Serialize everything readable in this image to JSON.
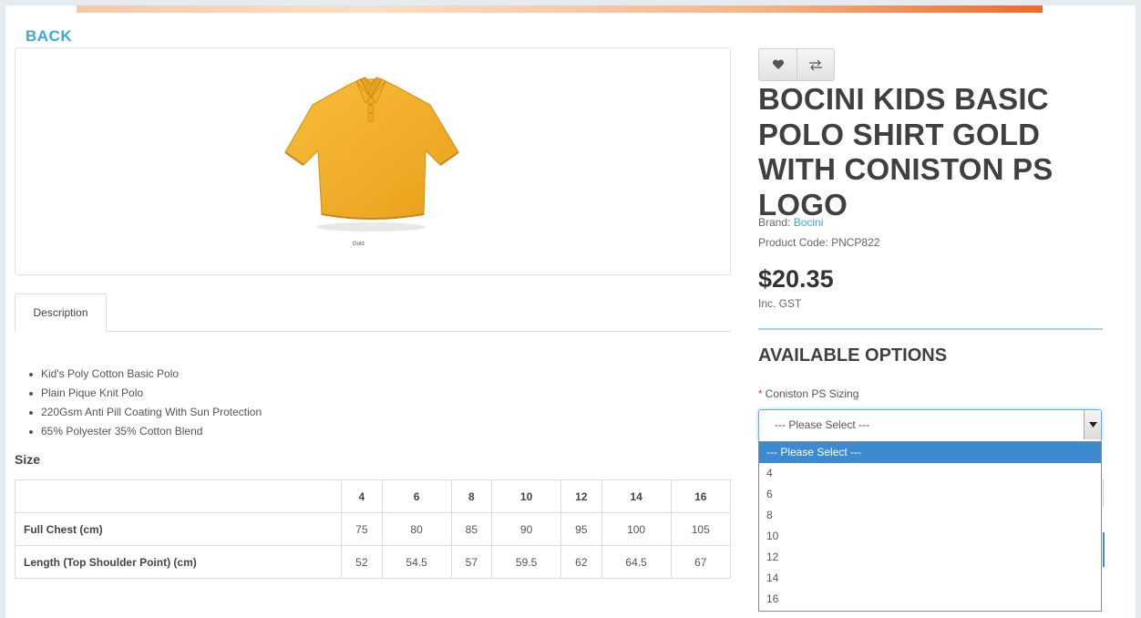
{
  "nav": {
    "back_label": "BACK"
  },
  "image": {
    "caption": "Gold"
  },
  "tabs": [
    {
      "label": "Description"
    }
  ],
  "description": {
    "bullets": [
      "Kid's Poly Cotton Basic Polo",
      "Plain Pique Knit Polo",
      "220Gsm Anti Pill Coating With Sun Protection",
      "65% Polyester 35% Cotton Blend"
    ]
  },
  "size_chart": {
    "heading": "Size",
    "columns": [
      "4",
      "6",
      "8",
      "10",
      "12",
      "14",
      "16"
    ],
    "rows": [
      {
        "label": "Full Chest (cm)",
        "values": [
          "75",
          "80",
          "85",
          "90",
          "95",
          "100",
          "105"
        ]
      },
      {
        "label": "Length (Top Shoulder Point) (cm)",
        "values": [
          "52",
          "54.5",
          "57",
          "59.5",
          "62",
          "64.5",
          "67"
        ]
      }
    ]
  },
  "product": {
    "title": "BOCINI KIDS BASIC POLO SHIRT GOLD WITH CONISTON PS LOGO",
    "brand_label": "Brand:",
    "brand_value": "Bocini",
    "code_label": "Product Code:",
    "code_value": "PNCP822",
    "price": "$20.35",
    "tax_note": "Inc. GST"
  },
  "options": {
    "heading": "AVAILABLE OPTIONS",
    "required_mark": "*",
    "field_label": "Coniston PS Sizing",
    "selected": "--- Please Select ---",
    "items": [
      "--- Please Select ---",
      "4",
      "6",
      "8",
      "10",
      "12",
      "14",
      "16"
    ]
  },
  "icons": {
    "wishlist": "heart-icon",
    "compare": "compare-arrows-icon",
    "select_arrow": "caret-down-icon"
  },
  "colors": {
    "accent_link": "#3aa9d8",
    "shirt": "#f5b12e",
    "highlight_option": "#3c8ad0",
    "required": "#e2382f"
  }
}
